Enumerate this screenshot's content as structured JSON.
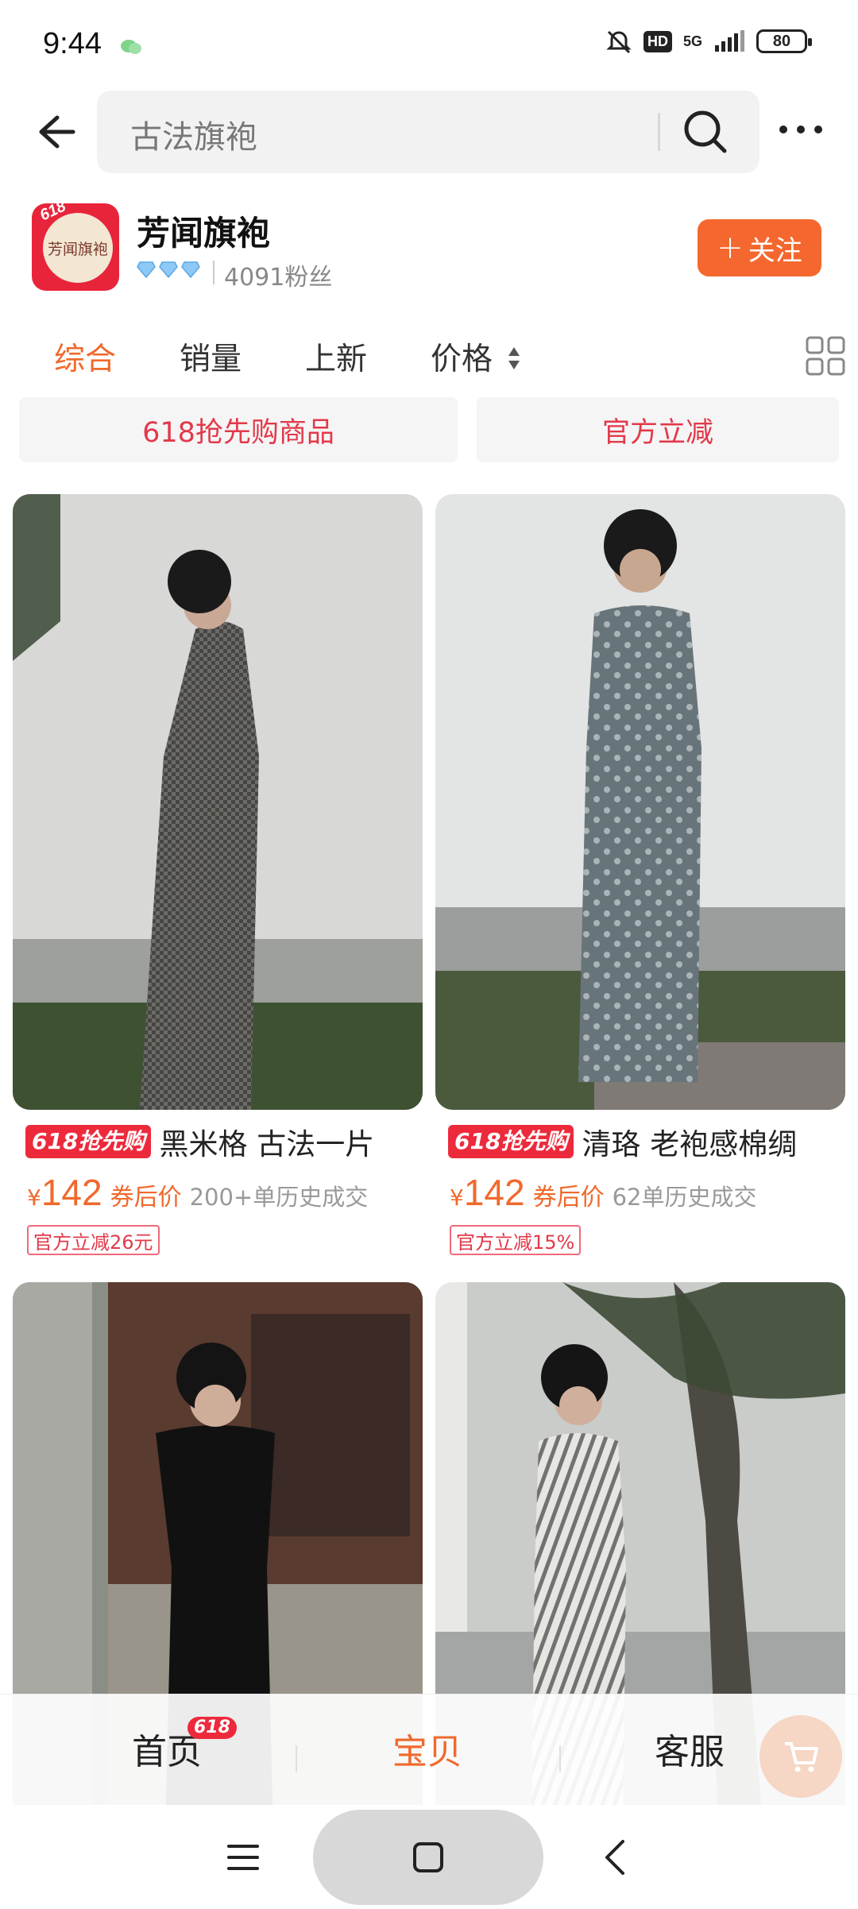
{
  "status_bar": {
    "time": "9:44",
    "hd": "HD",
    "network": "5G",
    "battery": "80"
  },
  "header": {
    "search_text": "古法旗袍"
  },
  "store": {
    "logo_text": "芳闻旗袍",
    "logo_badge": "618",
    "name": "芳闻旗袍",
    "fans": "4091粉丝",
    "follow_label": "关注"
  },
  "sort_tabs": [
    {
      "label": "综合",
      "active": true
    },
    {
      "label": "销量",
      "active": false
    },
    {
      "label": "上新",
      "active": false
    },
    {
      "label": "价格",
      "active": false
    }
  ],
  "chips": [
    "618抢先购商品",
    "官方立减"
  ],
  "products": [
    {
      "tag": "618抢先购",
      "title": "黑米格 古法一片",
      "yen": "¥",
      "price": "142",
      "price_note": "券后价",
      "sold": "200+单历史成交",
      "badge": "官方立减26元"
    },
    {
      "tag": "618抢先购",
      "title": "清珞 老袍感棉绸",
      "yen": "¥",
      "price": "142",
      "price_note": "券后价",
      "sold": "62单历史成交",
      "badge": "官方立减15%"
    },
    {
      "tag": "",
      "title": "",
      "yen": "",
      "price": "",
      "price_note": "",
      "sold": "",
      "badge": ""
    },
    {
      "tag": "",
      "title": "",
      "yen": "",
      "price": "",
      "price_note": "",
      "sold": "",
      "badge": ""
    }
  ],
  "shop_tabs": {
    "home": "首页",
    "home_badge": "618",
    "items": "宝贝",
    "service": "客服"
  },
  "colors": {
    "accent": "#f0692c",
    "promo_red": "#ed2a3c",
    "follow_orange": "#f4682f"
  },
  "icons": [
    "back-arrow-icon",
    "search-icon",
    "more-dots-icon",
    "grid-view-icon",
    "sort-arrows-icon",
    "cart-icon",
    "menu-icon",
    "home-square-icon",
    "back-chevron-icon"
  ]
}
